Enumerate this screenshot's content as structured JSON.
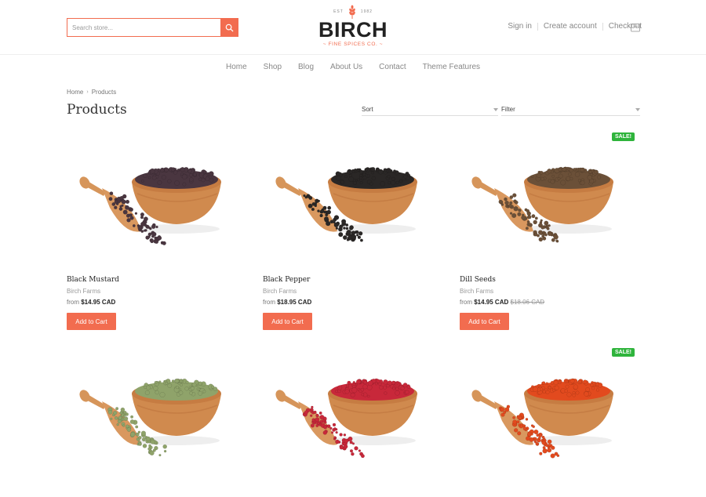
{
  "header": {
    "search_placeholder": "Search store...",
    "logo": {
      "est_left": "EST",
      "est_right": "1982",
      "name": "BIRCH",
      "tagline": "~ FINE SPICES CO. ~"
    },
    "links": {
      "sign_in": "Sign in",
      "create_account": "Create account",
      "checkout": "Checkout"
    }
  },
  "nav": [
    "Home",
    "Shop",
    "Blog",
    "About Us",
    "Contact",
    "Theme Features"
  ],
  "breadcrumb": {
    "home": "Home",
    "current": "Products"
  },
  "page_title": "Products",
  "sort_label": "Sort",
  "filter_label": "Filter",
  "accent_color": "#f26c4f",
  "sale_color": "#2fb43c",
  "products": [
    {
      "name": "Black Mustard",
      "vendor": "Birch Farms",
      "price_prefix": "from",
      "price": "$14.95 CAD",
      "compare_price": "",
      "sale": false,
      "sale_label": "",
      "button": "Add to Cart",
      "spice_color": "#4a3640"
    },
    {
      "name": "Black Pepper",
      "vendor": "Birch Farms",
      "price_prefix": "from",
      "price": "$18.95 CAD",
      "compare_price": "",
      "sale": false,
      "sale_label": "",
      "button": "Add to Cart",
      "spice_color": "#2a2726"
    },
    {
      "name": "Dill Seeds",
      "vendor": "Birch Farms",
      "price_prefix": "from",
      "price": "$14.95 CAD",
      "compare_price": "$18.06 CAD",
      "sale": true,
      "sale_label": "SALE!",
      "button": "Add to Cart",
      "spice_color": "#6b5038"
    },
    {
      "name": "",
      "vendor": "",
      "price_prefix": "",
      "price": "",
      "compare_price": "",
      "sale": false,
      "sale_label": "",
      "button": "",
      "spice_color": "#8fa36a"
    },
    {
      "name": "",
      "vendor": "",
      "price_prefix": "",
      "price": "",
      "compare_price": "",
      "sale": false,
      "sale_label": "",
      "button": "",
      "spice_color": "#c8283a"
    },
    {
      "name": "",
      "vendor": "",
      "price_prefix": "",
      "price": "",
      "compare_price": "",
      "sale": true,
      "sale_label": "SALE!",
      "button": "",
      "spice_color": "#e24a1e"
    }
  ]
}
